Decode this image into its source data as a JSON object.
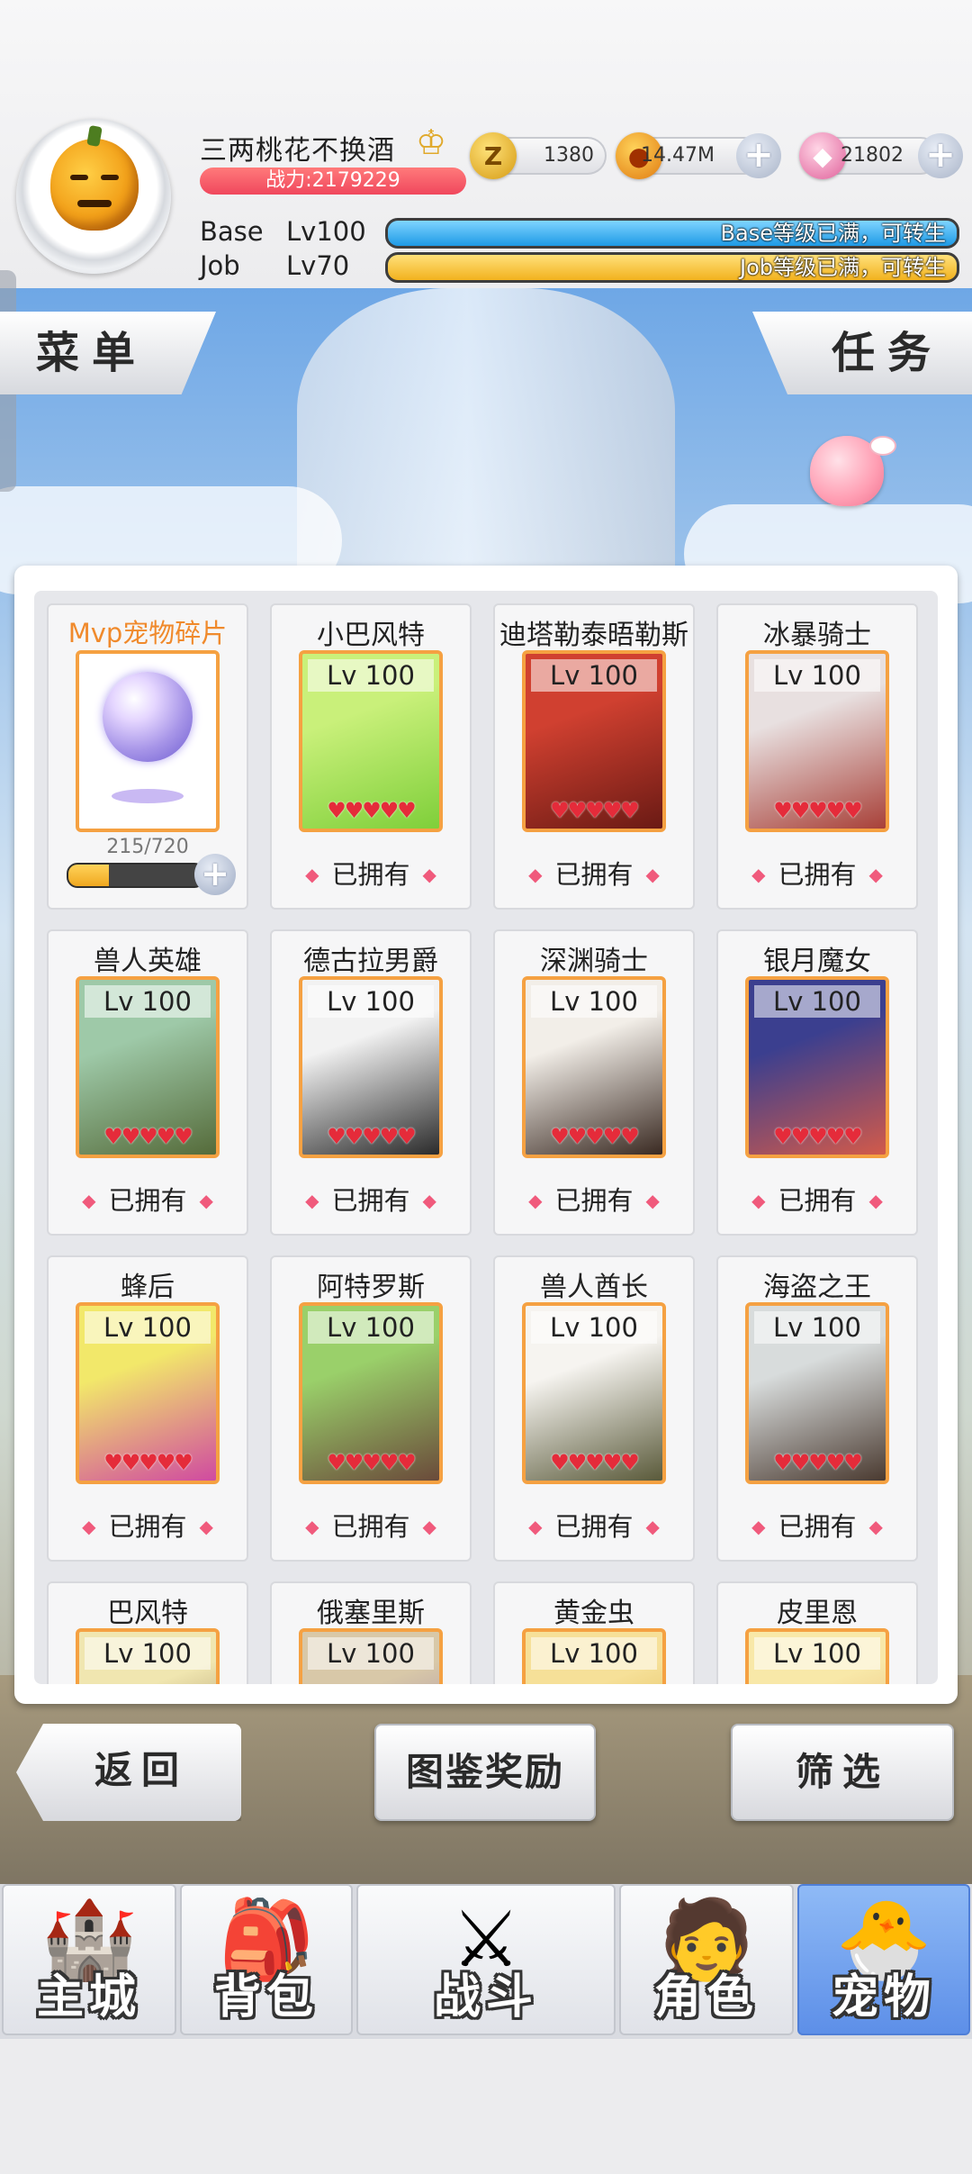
{
  "player": {
    "name": "三两桃花不换酒",
    "power": "战力:2179229",
    "base_label": "Base",
    "base_level": "Lv100",
    "base_status": "Base等级已满，可转生",
    "job_label": "Job",
    "job_level": "Lv70",
    "job_status": "Job等级已满，可转生"
  },
  "resources": [
    {
      "icon": "zeny-coin-icon",
      "value": "1380"
    },
    {
      "icon": "gold-pouch-icon",
      "value": "14.47M"
    },
    {
      "icon": "pink-gem-icon",
      "value": "21802"
    }
  ],
  "side_buttons": {
    "menu": "菜单",
    "task": "任务"
  },
  "mvp": {
    "title": "Mvp宠物碎片",
    "count": "215/720",
    "progress": 0.3
  },
  "pets": [
    {
      "name": "小巴风特",
      "level": "Lv 100",
      "status": "已拥有",
      "colors": [
        "#c9f07a",
        "#7fcf3a"
      ]
    },
    {
      "name": "迪塔勒泰晤勒斯",
      "level": "Lv 100",
      "status": "已拥有",
      "colors": [
        "#d04030",
        "#6a1a14"
      ]
    },
    {
      "name": "冰暴骑士",
      "level": "Lv 100",
      "status": "已拥有",
      "colors": [
        "#e8e0e0",
        "#a84038"
      ]
    },
    {
      "name": "兽人英雄",
      "level": "Lv 100",
      "status": "已拥有",
      "colors": [
        "#9ec9a8",
        "#556b3a"
      ]
    },
    {
      "name": "德古拉男爵",
      "level": "Lv 100",
      "status": "已拥有",
      "colors": [
        "#f2f2f2",
        "#2b2b2b"
      ]
    },
    {
      "name": "深渊骑士",
      "level": "Lv 100",
      "status": "已拥有",
      "colors": [
        "#f2eee8",
        "#3a2a22"
      ]
    },
    {
      "name": "银月魔女",
      "level": "Lv 100",
      "status": "已拥有",
      "colors": [
        "#3b3f8f",
        "#d25a4a"
      ]
    },
    {
      "name": "蜂后",
      "level": "Lv 100",
      "status": "已拥有",
      "colors": [
        "#f2e86a",
        "#d04aa0"
      ]
    },
    {
      "name": "阿特罗斯",
      "level": "Lv 100",
      "status": "已拥有",
      "colors": [
        "#9ad06a",
        "#6a4a3a"
      ]
    },
    {
      "name": "兽人酋长",
      "level": "Lv 100",
      "status": "已拥有",
      "colors": [
        "#f6f4f0",
        "#5a5a3a"
      ]
    },
    {
      "name": "海盗之王",
      "level": "Lv 100",
      "status": "已拥有",
      "colors": [
        "#d8dcdc",
        "#4a3a30"
      ]
    },
    {
      "name": "巴风特",
      "level": "Lv 100",
      "status": "",
      "colors": [
        "#f0e6b0",
        "#7a5a3a"
      ]
    },
    {
      "name": "俄塞里斯",
      "level": "Lv 100",
      "status": "",
      "colors": [
        "#d8c8a8",
        "#8a6aa8"
      ]
    },
    {
      "name": "黄金虫",
      "level": "Lv 100",
      "status": "",
      "colors": [
        "#f6e098",
        "#d0a030"
      ]
    },
    {
      "name": "皮里恩",
      "level": "Lv 100",
      "status": "",
      "colors": [
        "#f8e8a8",
        "#e0a060"
      ]
    }
  ],
  "hearts": "♥♥♥♥♥",
  "actions": {
    "back": "返回",
    "atlas_reward": "图鉴奖励",
    "filter": "筛选"
  },
  "nav": [
    {
      "label": "主城",
      "icon": "castle-icon",
      "glyph": "🏰"
    },
    {
      "label": "背包",
      "icon": "backpack-icon",
      "glyph": "🎒"
    },
    {
      "label": "战斗",
      "icon": "battle-shield-icon",
      "glyph": "⚔"
    },
    {
      "label": "角色",
      "icon": "character-icon",
      "glyph": "🧑"
    },
    {
      "label": "宠物",
      "icon": "pet-poring-icon",
      "glyph": "🐣",
      "active": true
    }
  ]
}
